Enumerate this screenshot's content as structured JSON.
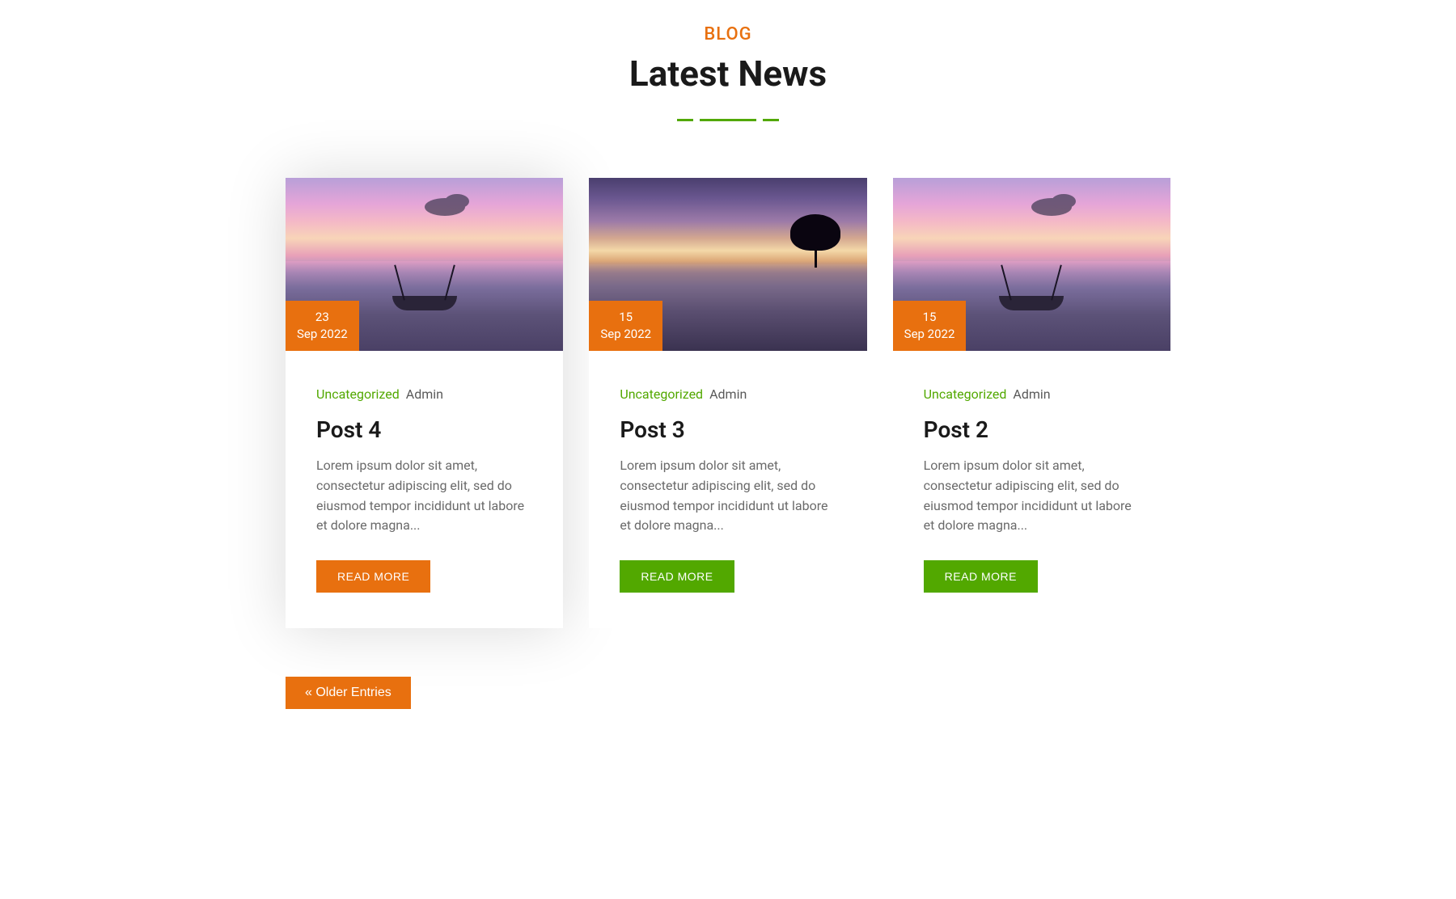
{
  "header": {
    "label": "BLOG",
    "title": "Latest News"
  },
  "posts": [
    {
      "date_day": "23",
      "date_month_year": "Sep 2022",
      "category": "Uncategorized",
      "author": "Admin",
      "title": "Post 4",
      "excerpt": "Lorem ipsum dolor sit amet, consectetur adipiscing elit, sed do eiusmod tempor incididunt ut labore et dolore magna...",
      "read_more": "READ MORE",
      "image_type": "boat",
      "hovered": true
    },
    {
      "date_day": "15",
      "date_month_year": "Sep 2022",
      "category": "Uncategorized",
      "author": "Admin",
      "title": "Post 3",
      "excerpt": "Lorem ipsum dolor sit amet, consectetur adipiscing elit, sed do eiusmod tempor incididunt ut labore et dolore magna...",
      "read_more": "READ MORE",
      "image_type": "tree",
      "hovered": false
    },
    {
      "date_day": "15",
      "date_month_year": "Sep 2022",
      "category": "Uncategorized",
      "author": "Admin",
      "title": "Post 2",
      "excerpt": "Lorem ipsum dolor sit amet, consectetur adipiscing elit, sed do eiusmod tempor incididunt ut labore et dolore magna...",
      "read_more": "READ MORE",
      "image_type": "boat",
      "hovered": false
    }
  ],
  "pagination": {
    "older_entries": "« Older Entries"
  }
}
